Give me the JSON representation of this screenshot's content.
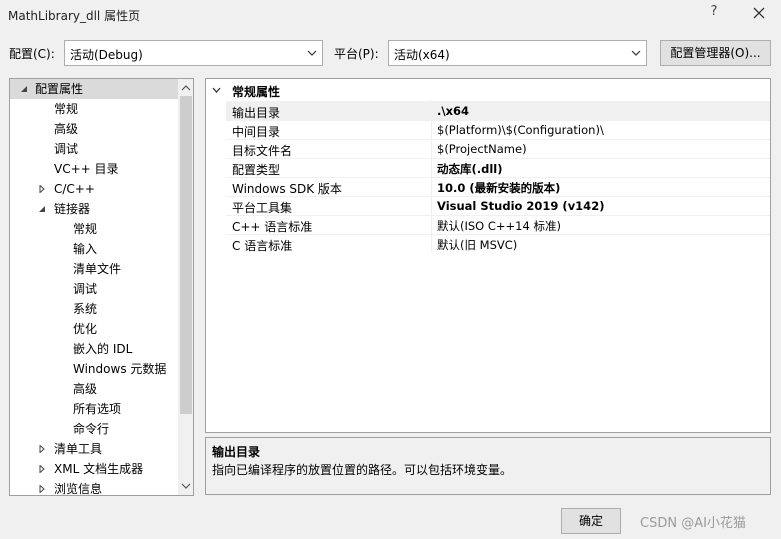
{
  "window": {
    "title": "MathLibrary_dll 属性页",
    "help_glyph": "?"
  },
  "toolbar": {
    "config_label": "配置(C):",
    "config_value": "活动(Debug)",
    "platform_label": "平台(P):",
    "platform_value": "活动(x64)",
    "config_manager_label": "配置管理器(O)..."
  },
  "tree": {
    "items": [
      {
        "label": "配置属性",
        "expanded": true,
        "selected": true
      },
      {
        "label": "常规"
      },
      {
        "label": "高级"
      },
      {
        "label": "调试"
      },
      {
        "label": "VC++ 目录"
      },
      {
        "label": "C/C++",
        "expanded": false
      },
      {
        "label": "链接器",
        "expanded": true
      },
      {
        "label": "常规"
      },
      {
        "label": "输入"
      },
      {
        "label": "清单文件"
      },
      {
        "label": "调试"
      },
      {
        "label": "系统"
      },
      {
        "label": "优化"
      },
      {
        "label": "嵌入的 IDL"
      },
      {
        "label": "Windows 元数据"
      },
      {
        "label": "高级"
      },
      {
        "label": "所有选项"
      },
      {
        "label": "命令行"
      },
      {
        "label": "清单工具",
        "expanded": false
      },
      {
        "label": "XML 文档生成器",
        "expanded": false
      },
      {
        "label": "浏览信息",
        "expanded": false
      }
    ]
  },
  "grid": {
    "category": "常规属性",
    "rows": [
      {
        "name": "输出目录",
        "value": ".\\x64",
        "bold": true
      },
      {
        "name": "中间目录",
        "value": "$(Platform)\\$(Configuration)\\",
        "bold": false
      },
      {
        "name": "目标文件名",
        "value": "$(ProjectName)",
        "bold": false
      },
      {
        "name": "配置类型",
        "value": "动态库(.dll)",
        "bold": true
      },
      {
        "name": "Windows SDK 版本",
        "value": "10.0 (最新安装的版本)",
        "bold": true
      },
      {
        "name": "平台工具集",
        "value": "Visual Studio 2019 (v142)",
        "bold": true
      },
      {
        "name": "C++ 语言标准",
        "value": "默认(ISO C++14 标准)",
        "bold": false
      },
      {
        "name": "C 语言标准",
        "value": "默认(旧 MSVC)",
        "bold": false
      }
    ]
  },
  "description": {
    "title": "输出目录",
    "text": "指向已编译程序的放置位置的路径。可以包括环境变量。"
  },
  "footer": {
    "ok_label": "确定",
    "watermark": "CSDN @AI小花猫"
  }
}
